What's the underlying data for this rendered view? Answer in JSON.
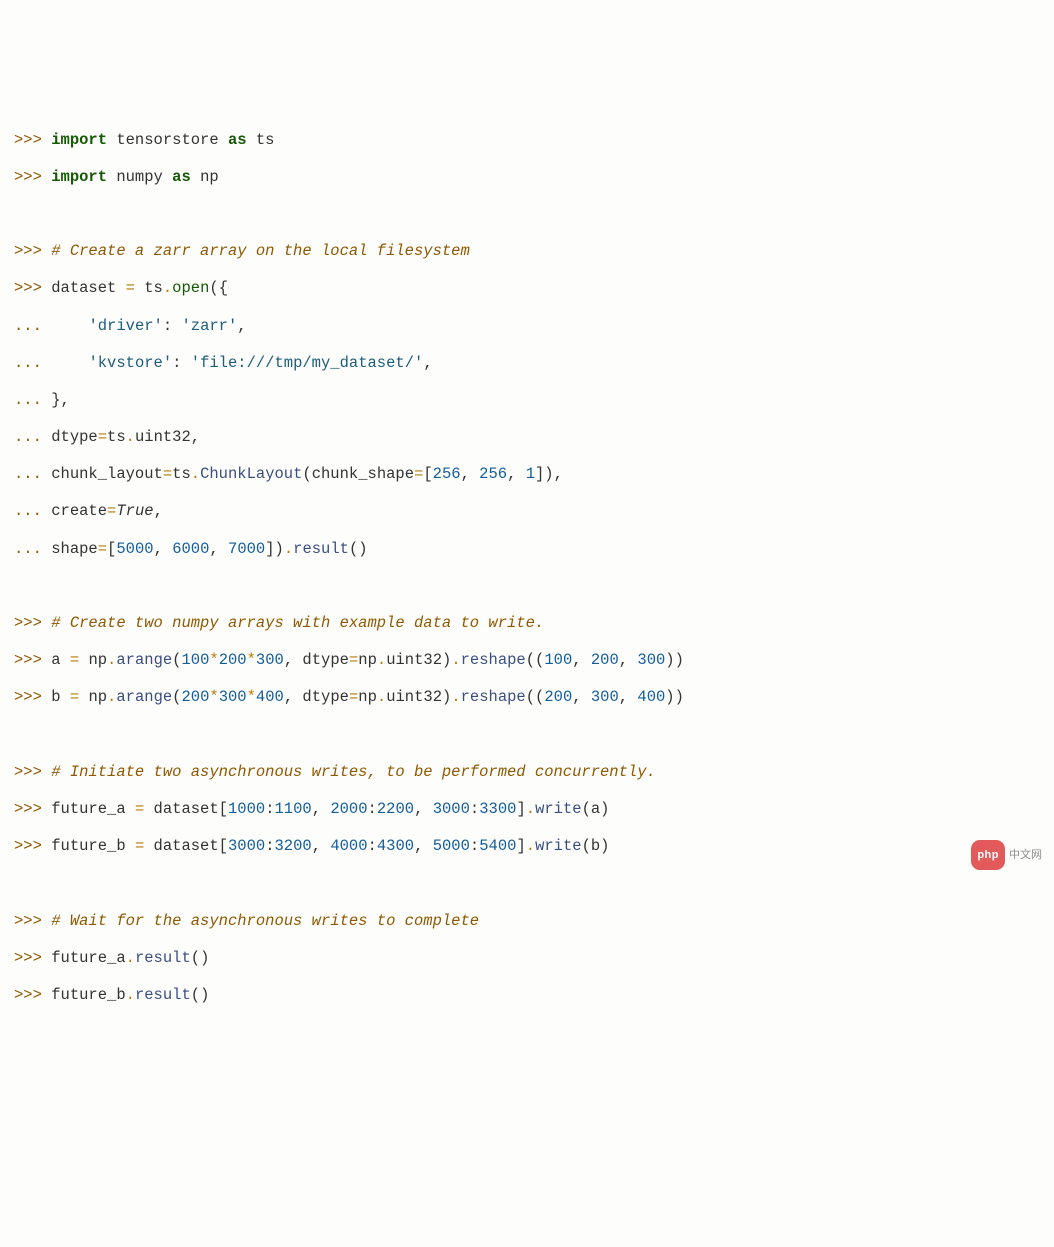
{
  "lines": [
    [
      {
        "t": ">>> ",
        "c": "c-prompt"
      },
      {
        "t": "import",
        "c": "c-keyword"
      },
      {
        "t": " tensorstore ",
        "c": "c-name"
      },
      {
        "t": "as",
        "c": "c-keyword"
      },
      {
        "t": " ts",
        "c": "c-name"
      }
    ],
    [
      {
        "t": ">>> ",
        "c": "c-prompt"
      },
      {
        "t": "import",
        "c": "c-keyword"
      },
      {
        "t": " numpy ",
        "c": "c-name"
      },
      {
        "t": "as",
        "c": "c-keyword"
      },
      {
        "t": " np",
        "c": "c-name"
      }
    ],
    [],
    [
      {
        "t": ">>> ",
        "c": "c-prompt"
      },
      {
        "t": "# Create a zarr array on the local filesystem",
        "c": "c-comment"
      }
    ],
    [
      {
        "t": ">>> ",
        "c": "c-prompt"
      },
      {
        "t": "dataset ",
        "c": "c-name"
      },
      {
        "t": "=",
        "c": "c-op"
      },
      {
        "t": " ts",
        "c": "c-name"
      },
      {
        "t": ".",
        "c": "c-op"
      },
      {
        "t": "open",
        "c": "c-builtin"
      },
      {
        "t": "({",
        "c": "c-name"
      }
    ],
    [
      {
        "t": "... ",
        "c": "c-prompt"
      },
      {
        "t": "    ",
        "c": "c-name"
      },
      {
        "t": "'driver'",
        "c": "c-string"
      },
      {
        "t": ": ",
        "c": "c-name"
      },
      {
        "t": "'zarr'",
        "c": "c-string"
      },
      {
        "t": ",",
        "c": "c-name"
      }
    ],
    [
      {
        "t": "... ",
        "c": "c-prompt"
      },
      {
        "t": "    ",
        "c": "c-name"
      },
      {
        "t": "'kvstore'",
        "c": "c-string"
      },
      {
        "t": ": ",
        "c": "c-name"
      },
      {
        "t": "'file:///tmp/my_dataset/'",
        "c": "c-string"
      },
      {
        "t": ",",
        "c": "c-name"
      }
    ],
    [
      {
        "t": "... ",
        "c": "c-prompt"
      },
      {
        "t": "},",
        "c": "c-name"
      }
    ],
    [
      {
        "t": "... ",
        "c": "c-prompt"
      },
      {
        "t": "dtype",
        "c": "c-name"
      },
      {
        "t": "=",
        "c": "c-op"
      },
      {
        "t": "ts",
        "c": "c-name"
      },
      {
        "t": ".",
        "c": "c-op"
      },
      {
        "t": "uint32,",
        "c": "c-name"
      }
    ],
    [
      {
        "t": "... ",
        "c": "c-prompt"
      },
      {
        "t": "chunk_layout",
        "c": "c-name"
      },
      {
        "t": "=",
        "c": "c-op"
      },
      {
        "t": "ts",
        "c": "c-name"
      },
      {
        "t": ".",
        "c": "c-op"
      },
      {
        "t": "ChunkLayout",
        "c": "c-call"
      },
      {
        "t": "(chunk_shape",
        "c": "c-name"
      },
      {
        "t": "=",
        "c": "c-op"
      },
      {
        "t": "[",
        "c": "c-name"
      },
      {
        "t": "256",
        "c": "c-number"
      },
      {
        "t": ", ",
        "c": "c-name"
      },
      {
        "t": "256",
        "c": "c-number"
      },
      {
        "t": ", ",
        "c": "c-name"
      },
      {
        "t": "1",
        "c": "c-number"
      },
      {
        "t": "]),",
        "c": "c-name"
      }
    ],
    [
      {
        "t": "... ",
        "c": "c-prompt"
      },
      {
        "t": "create",
        "c": "c-name"
      },
      {
        "t": "=",
        "c": "c-op"
      },
      {
        "t": "True",
        "c": "c-bool"
      },
      {
        "t": ",",
        "c": "c-name"
      }
    ],
    [
      {
        "t": "... ",
        "c": "c-prompt"
      },
      {
        "t": "shape",
        "c": "c-name"
      },
      {
        "t": "=",
        "c": "c-op"
      },
      {
        "t": "[",
        "c": "c-name"
      },
      {
        "t": "5000",
        "c": "c-number"
      },
      {
        "t": ", ",
        "c": "c-name"
      },
      {
        "t": "6000",
        "c": "c-number"
      },
      {
        "t": ", ",
        "c": "c-name"
      },
      {
        "t": "7000",
        "c": "c-number"
      },
      {
        "t": "])",
        "c": "c-name"
      },
      {
        "t": ".",
        "c": "c-op"
      },
      {
        "t": "result",
        "c": "c-call"
      },
      {
        "t": "()",
        "c": "c-name"
      }
    ],
    [],
    [
      {
        "t": ">>> ",
        "c": "c-prompt"
      },
      {
        "t": "# Create two numpy arrays with example data to write.",
        "c": "c-comment"
      }
    ],
    [
      {
        "t": ">>> ",
        "c": "c-prompt"
      },
      {
        "t": "a ",
        "c": "c-name"
      },
      {
        "t": "=",
        "c": "c-op"
      },
      {
        "t": " np",
        "c": "c-name"
      },
      {
        "t": ".",
        "c": "c-op"
      },
      {
        "t": "arange",
        "c": "c-call"
      },
      {
        "t": "(",
        "c": "c-name"
      },
      {
        "t": "100",
        "c": "c-number"
      },
      {
        "t": "*",
        "c": "c-op"
      },
      {
        "t": "200",
        "c": "c-number"
      },
      {
        "t": "*",
        "c": "c-op"
      },
      {
        "t": "300",
        "c": "c-number"
      },
      {
        "t": ", dtype",
        "c": "c-name"
      },
      {
        "t": "=",
        "c": "c-op"
      },
      {
        "t": "np",
        "c": "c-name"
      },
      {
        "t": ".",
        "c": "c-op"
      },
      {
        "t": "uint32)",
        "c": "c-name"
      },
      {
        "t": ".",
        "c": "c-op"
      },
      {
        "t": "reshape",
        "c": "c-call"
      },
      {
        "t": "((",
        "c": "c-name"
      },
      {
        "t": "100",
        "c": "c-number"
      },
      {
        "t": ", ",
        "c": "c-name"
      },
      {
        "t": "200",
        "c": "c-number"
      },
      {
        "t": ", ",
        "c": "c-name"
      },
      {
        "t": "300",
        "c": "c-number"
      },
      {
        "t": "))",
        "c": "c-name"
      }
    ],
    [
      {
        "t": ">>> ",
        "c": "c-prompt"
      },
      {
        "t": "b ",
        "c": "c-name"
      },
      {
        "t": "=",
        "c": "c-op"
      },
      {
        "t": " np",
        "c": "c-name"
      },
      {
        "t": ".",
        "c": "c-op"
      },
      {
        "t": "arange",
        "c": "c-call"
      },
      {
        "t": "(",
        "c": "c-name"
      },
      {
        "t": "200",
        "c": "c-number"
      },
      {
        "t": "*",
        "c": "c-op"
      },
      {
        "t": "300",
        "c": "c-number"
      },
      {
        "t": "*",
        "c": "c-op"
      },
      {
        "t": "400",
        "c": "c-number"
      },
      {
        "t": ", dtype",
        "c": "c-name"
      },
      {
        "t": "=",
        "c": "c-op"
      },
      {
        "t": "np",
        "c": "c-name"
      },
      {
        "t": ".",
        "c": "c-op"
      },
      {
        "t": "uint32)",
        "c": "c-name"
      },
      {
        "t": ".",
        "c": "c-op"
      },
      {
        "t": "reshape",
        "c": "c-call"
      },
      {
        "t": "((",
        "c": "c-name"
      },
      {
        "t": "200",
        "c": "c-number"
      },
      {
        "t": ", ",
        "c": "c-name"
      },
      {
        "t": "300",
        "c": "c-number"
      },
      {
        "t": ", ",
        "c": "c-name"
      },
      {
        "t": "400",
        "c": "c-number"
      },
      {
        "t": "))",
        "c": "c-name"
      }
    ],
    [],
    [
      {
        "t": ">>> ",
        "c": "c-prompt"
      },
      {
        "t": "# Initiate two asynchronous writes, to be performed concurrently.",
        "c": "c-comment"
      }
    ],
    [
      {
        "t": ">>> ",
        "c": "c-prompt"
      },
      {
        "t": "future_a ",
        "c": "c-name"
      },
      {
        "t": "=",
        "c": "c-op"
      },
      {
        "t": " dataset[",
        "c": "c-name"
      },
      {
        "t": "1000",
        "c": "c-number"
      },
      {
        "t": ":",
        "c": "c-name"
      },
      {
        "t": "1100",
        "c": "c-number"
      },
      {
        "t": ", ",
        "c": "c-name"
      },
      {
        "t": "2000",
        "c": "c-number"
      },
      {
        "t": ":",
        "c": "c-name"
      },
      {
        "t": "2200",
        "c": "c-number"
      },
      {
        "t": ", ",
        "c": "c-name"
      },
      {
        "t": "3000",
        "c": "c-number"
      },
      {
        "t": ":",
        "c": "c-name"
      },
      {
        "t": "3300",
        "c": "c-number"
      },
      {
        "t": "]",
        "c": "c-name"
      },
      {
        "t": ".",
        "c": "c-op"
      },
      {
        "t": "write",
        "c": "c-call"
      },
      {
        "t": "(a)",
        "c": "c-name"
      }
    ],
    [
      {
        "t": ">>> ",
        "c": "c-prompt"
      },
      {
        "t": "future_b ",
        "c": "c-name"
      },
      {
        "t": "=",
        "c": "c-op"
      },
      {
        "t": " dataset[",
        "c": "c-name"
      },
      {
        "t": "3000",
        "c": "c-number"
      },
      {
        "t": ":",
        "c": "c-name"
      },
      {
        "t": "3200",
        "c": "c-number"
      },
      {
        "t": ", ",
        "c": "c-name"
      },
      {
        "t": "4000",
        "c": "c-number"
      },
      {
        "t": ":",
        "c": "c-name"
      },
      {
        "t": "4300",
        "c": "c-number"
      },
      {
        "t": ", ",
        "c": "c-name"
      },
      {
        "t": "5000",
        "c": "c-number"
      },
      {
        "t": ":",
        "c": "c-name"
      },
      {
        "t": "5400",
        "c": "c-number"
      },
      {
        "t": "]",
        "c": "c-name"
      },
      {
        "t": ".",
        "c": "c-op"
      },
      {
        "t": "write",
        "c": "c-call"
      },
      {
        "t": "(b)",
        "c": "c-name"
      }
    ],
    [],
    [
      {
        "t": ">>> ",
        "c": "c-prompt"
      },
      {
        "t": "# Wait for the asynchronous writes to complete",
        "c": "c-comment"
      }
    ],
    [
      {
        "t": ">>> ",
        "c": "c-prompt"
      },
      {
        "t": "future_a",
        "c": "c-name"
      },
      {
        "t": ".",
        "c": "c-op"
      },
      {
        "t": "result",
        "c": "c-call"
      },
      {
        "t": "()",
        "c": "c-name"
      }
    ],
    [
      {
        "t": ">>> ",
        "c": "c-prompt"
      },
      {
        "t": "future_b",
        "c": "c-name"
      },
      {
        "t": ".",
        "c": "c-op"
      },
      {
        "t": "result",
        "c": "c-call"
      },
      {
        "t": "()",
        "c": "c-name"
      }
    ]
  ],
  "watermark": {
    "pill": "php",
    "text": "中文网"
  }
}
